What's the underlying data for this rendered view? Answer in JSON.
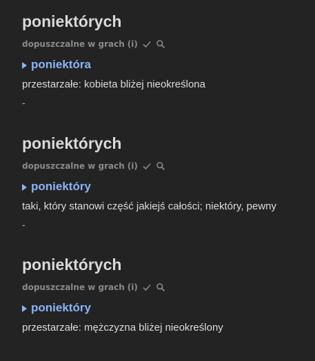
{
  "entries": [
    {
      "headword": "poniektórych",
      "status": "dopuszczalne w grach",
      "info": "(i)",
      "lemma": "poniektóra",
      "definition": "przestarzałe: kobieta bliżej nieokreślona",
      "separator": "-"
    },
    {
      "headword": "poniektórych",
      "status": "dopuszczalne w grach",
      "info": "(i)",
      "lemma": "poniektóry",
      "definition": "taki, który stanowi część jakiejś całości; niektóry, pewny",
      "separator": "-"
    },
    {
      "headword": "poniektórych",
      "status": "dopuszczalne w grach",
      "info": "(i)",
      "lemma": "poniektóry",
      "definition": "przestarzałe: mężczyzna bliżej nieokreślony"
    }
  ],
  "icons": {
    "check": "check-icon",
    "search": "search-icon",
    "expand": "triangle-right-icon"
  },
  "colors": {
    "background": "#232323",
    "headword": "#d9d9d9",
    "meta": "#8a8a8a",
    "link": "#8ab4f8",
    "text": "#dcdcdc"
  }
}
